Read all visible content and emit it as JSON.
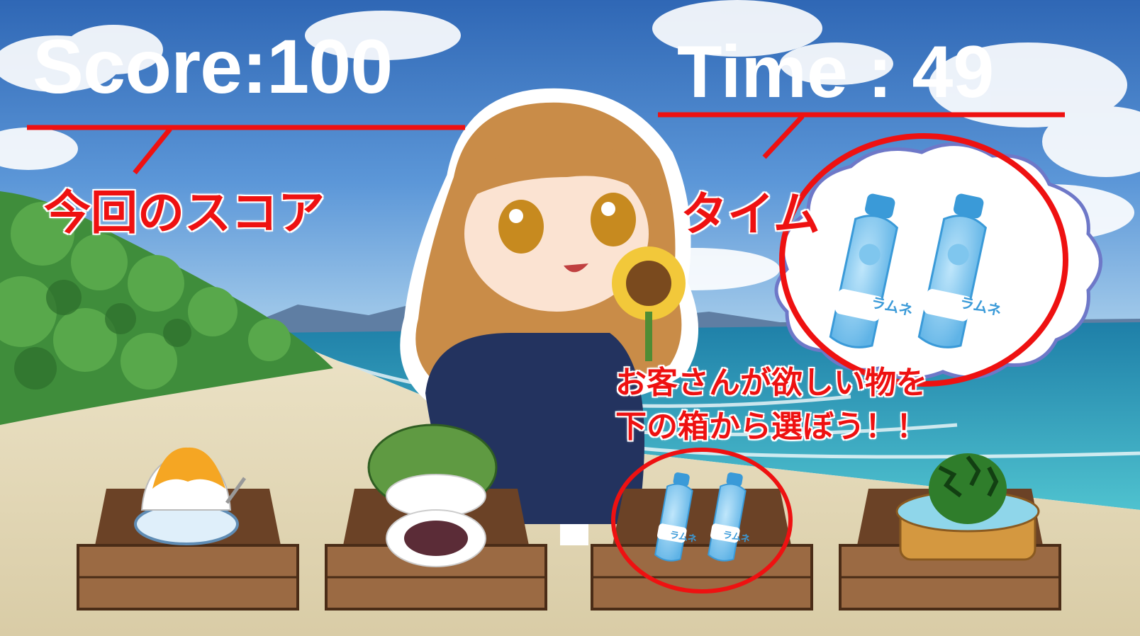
{
  "hud": {
    "score_text": "Score:100",
    "time_label": "Time",
    "time_separator": ":",
    "time_value": "49"
  },
  "annotations": {
    "score_note": "今回のスコア",
    "time_note": "タイム",
    "instruction_line1": "お客さんが欲しい物を",
    "instruction_line2": "下の箱から選ぼう！！"
  },
  "request": {
    "item": "ramune",
    "bottle_label": "ラムネ"
  },
  "boxes": [
    {
      "item": "shaved-ice",
      "label": ""
    },
    {
      "item": "sakura-mochi",
      "label": ""
    },
    {
      "item": "ramune",
      "label": "ラムネ",
      "highlighted": true
    },
    {
      "item": "watermelon",
      "label": ""
    }
  ],
  "colors": {
    "annotation_red": "#ee1111",
    "hud_white": "#ffffff",
    "sky": "#3f7fcf",
    "sea": "#2fa8c4",
    "sand": "#e6dcbf",
    "box_wood": "#9b6a43"
  }
}
